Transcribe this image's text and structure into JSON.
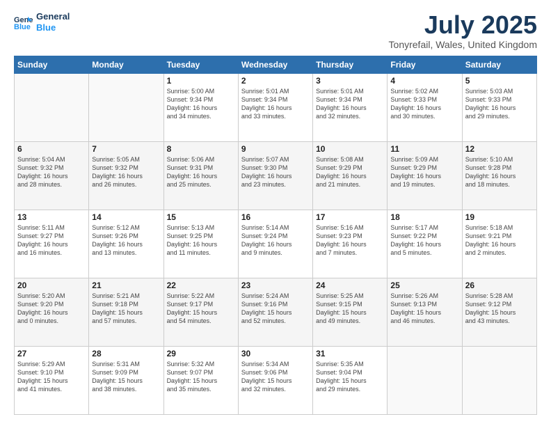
{
  "logo": {
    "line1": "General",
    "line2": "Blue"
  },
  "title": "July 2025",
  "subtitle": "Tonyrefail, Wales, United Kingdom",
  "weekdays": [
    "Sunday",
    "Monday",
    "Tuesday",
    "Wednesday",
    "Thursday",
    "Friday",
    "Saturday"
  ],
  "weeks": [
    [
      {
        "day": "",
        "info": ""
      },
      {
        "day": "",
        "info": ""
      },
      {
        "day": "1",
        "info": "Sunrise: 5:00 AM\nSunset: 9:34 PM\nDaylight: 16 hours\nand 34 minutes."
      },
      {
        "day": "2",
        "info": "Sunrise: 5:01 AM\nSunset: 9:34 PM\nDaylight: 16 hours\nand 33 minutes."
      },
      {
        "day": "3",
        "info": "Sunrise: 5:01 AM\nSunset: 9:34 PM\nDaylight: 16 hours\nand 32 minutes."
      },
      {
        "day": "4",
        "info": "Sunrise: 5:02 AM\nSunset: 9:33 PM\nDaylight: 16 hours\nand 30 minutes."
      },
      {
        "day": "5",
        "info": "Sunrise: 5:03 AM\nSunset: 9:33 PM\nDaylight: 16 hours\nand 29 minutes."
      }
    ],
    [
      {
        "day": "6",
        "info": "Sunrise: 5:04 AM\nSunset: 9:32 PM\nDaylight: 16 hours\nand 28 minutes."
      },
      {
        "day": "7",
        "info": "Sunrise: 5:05 AM\nSunset: 9:32 PM\nDaylight: 16 hours\nand 26 minutes."
      },
      {
        "day": "8",
        "info": "Sunrise: 5:06 AM\nSunset: 9:31 PM\nDaylight: 16 hours\nand 25 minutes."
      },
      {
        "day": "9",
        "info": "Sunrise: 5:07 AM\nSunset: 9:30 PM\nDaylight: 16 hours\nand 23 minutes."
      },
      {
        "day": "10",
        "info": "Sunrise: 5:08 AM\nSunset: 9:29 PM\nDaylight: 16 hours\nand 21 minutes."
      },
      {
        "day": "11",
        "info": "Sunrise: 5:09 AM\nSunset: 9:29 PM\nDaylight: 16 hours\nand 19 minutes."
      },
      {
        "day": "12",
        "info": "Sunrise: 5:10 AM\nSunset: 9:28 PM\nDaylight: 16 hours\nand 18 minutes."
      }
    ],
    [
      {
        "day": "13",
        "info": "Sunrise: 5:11 AM\nSunset: 9:27 PM\nDaylight: 16 hours\nand 16 minutes."
      },
      {
        "day": "14",
        "info": "Sunrise: 5:12 AM\nSunset: 9:26 PM\nDaylight: 16 hours\nand 13 minutes."
      },
      {
        "day": "15",
        "info": "Sunrise: 5:13 AM\nSunset: 9:25 PM\nDaylight: 16 hours\nand 11 minutes."
      },
      {
        "day": "16",
        "info": "Sunrise: 5:14 AM\nSunset: 9:24 PM\nDaylight: 16 hours\nand 9 minutes."
      },
      {
        "day": "17",
        "info": "Sunrise: 5:16 AM\nSunset: 9:23 PM\nDaylight: 16 hours\nand 7 minutes."
      },
      {
        "day": "18",
        "info": "Sunrise: 5:17 AM\nSunset: 9:22 PM\nDaylight: 16 hours\nand 5 minutes."
      },
      {
        "day": "19",
        "info": "Sunrise: 5:18 AM\nSunset: 9:21 PM\nDaylight: 16 hours\nand 2 minutes."
      }
    ],
    [
      {
        "day": "20",
        "info": "Sunrise: 5:20 AM\nSunset: 9:20 PM\nDaylight: 16 hours\nand 0 minutes."
      },
      {
        "day": "21",
        "info": "Sunrise: 5:21 AM\nSunset: 9:18 PM\nDaylight: 15 hours\nand 57 minutes."
      },
      {
        "day": "22",
        "info": "Sunrise: 5:22 AM\nSunset: 9:17 PM\nDaylight: 15 hours\nand 54 minutes."
      },
      {
        "day": "23",
        "info": "Sunrise: 5:24 AM\nSunset: 9:16 PM\nDaylight: 15 hours\nand 52 minutes."
      },
      {
        "day": "24",
        "info": "Sunrise: 5:25 AM\nSunset: 9:15 PM\nDaylight: 15 hours\nand 49 minutes."
      },
      {
        "day": "25",
        "info": "Sunrise: 5:26 AM\nSunset: 9:13 PM\nDaylight: 15 hours\nand 46 minutes."
      },
      {
        "day": "26",
        "info": "Sunrise: 5:28 AM\nSunset: 9:12 PM\nDaylight: 15 hours\nand 43 minutes."
      }
    ],
    [
      {
        "day": "27",
        "info": "Sunrise: 5:29 AM\nSunset: 9:10 PM\nDaylight: 15 hours\nand 41 minutes."
      },
      {
        "day": "28",
        "info": "Sunrise: 5:31 AM\nSunset: 9:09 PM\nDaylight: 15 hours\nand 38 minutes."
      },
      {
        "day": "29",
        "info": "Sunrise: 5:32 AM\nSunset: 9:07 PM\nDaylight: 15 hours\nand 35 minutes."
      },
      {
        "day": "30",
        "info": "Sunrise: 5:34 AM\nSunset: 9:06 PM\nDaylight: 15 hours\nand 32 minutes."
      },
      {
        "day": "31",
        "info": "Sunrise: 5:35 AM\nSunset: 9:04 PM\nDaylight: 15 hours\nand 29 minutes."
      },
      {
        "day": "",
        "info": ""
      },
      {
        "day": "",
        "info": ""
      }
    ]
  ]
}
